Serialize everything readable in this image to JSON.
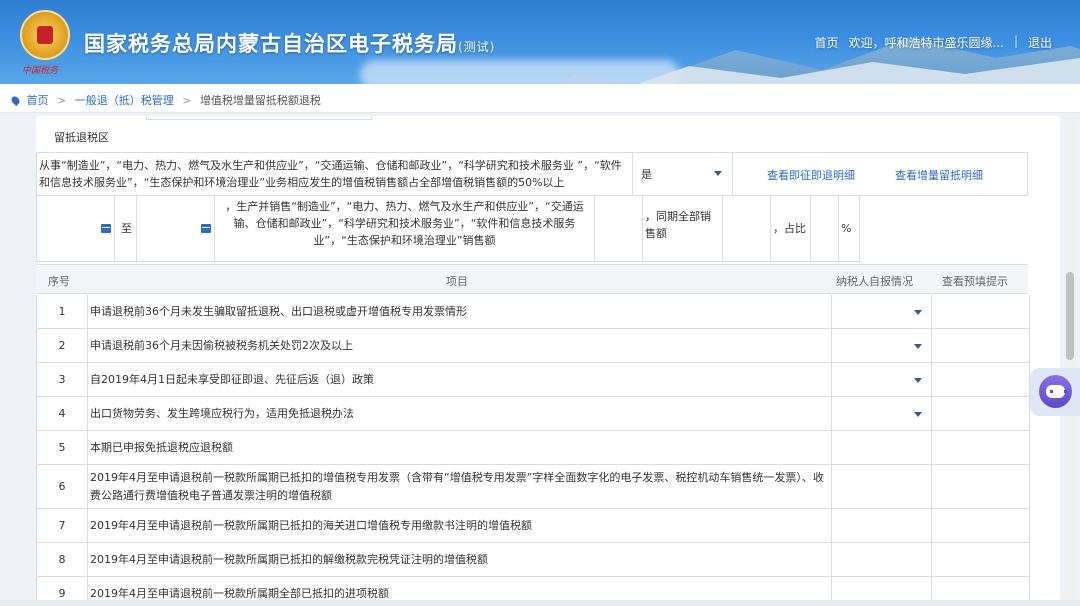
{
  "header": {
    "title": "国家税务总局内蒙古自治区电子税务局",
    "title_suffix": "(测试)",
    "emblem_caption": "中国税务",
    "nav": {
      "home": "首页",
      "welcome": "欢迎，呼和浩特市盛乐圆缘...",
      "separator": "|",
      "logout": "退出"
    }
  },
  "breadcrumb": {
    "home": "首页",
    "level1": "一般退（抵）税管理",
    "current": "增值税增量留抵税额退税",
    "arrow": ">"
  },
  "section": {
    "title": "留抵退税区"
  },
  "condition_row": {
    "description": "从事“制造业”，“电力、热力、燃气及水生产和供应业”，“交通运输、仓储和邮政业”，“科学研究和技术服务业 ”，“软件和信息技术服务业”，“生态保护和环境治理业”业务相应发生的增值税销售额占全部增值税销售额的50%以上",
    "select_value": "是",
    "link_refund_detail": "查看即征即退明细",
    "link_increment_detail": "查看增量留抵明细"
  },
  "period_row": {
    "to_label": "至",
    "desc": "，生产并销售“制造业”，“电力、热力、燃气及水生产和供应业”，“交通运输、仓储和邮政业”，“科学研究和技术服务业”，“软件和信息技术服务业”，“生态保护和环境治理业”销售额",
    "same_period_label": "，同期全部销售额",
    "ratio_label": "，占比",
    "percent": "%"
  },
  "table": {
    "headers": {
      "num": "序号",
      "item": "项目",
      "self_report": "纳税人自报情况",
      "hint": "查看预填提示"
    },
    "rows": [
      {
        "num": "1",
        "item": "申请退税前36个月未发生骗取留抵退税、出口退税或虚开增值税专用发票情形",
        "has_select": true
      },
      {
        "num": "2",
        "item": "申请退税前36个月未因偷税被税务机关处罚2次及以上",
        "has_select": true
      },
      {
        "num": "3",
        "item": "自2019年4月1日起未享受即征即退、先征后返（退）政策",
        "has_select": true
      },
      {
        "num": "4",
        "item": "出口货物劳务、发生跨境应税行为，适用免抵退税办法",
        "has_select": true
      },
      {
        "num": "5",
        "item": "本期已申报免抵退税应退税额",
        "has_select": false
      },
      {
        "num": "6",
        "item": "2019年4月至申请退税前一税款所属期已抵扣的增值税专用发票（含带有“增值税专用发票”字样全面数字化的电子发票、税控机动车销售统一发票）、收费公路通行费增值税电子普通发票注明的增值税额",
        "has_select": false
      },
      {
        "num": "7",
        "item": "2019年4月至申请退税前一税款所属期已抵扣的海关进口增值税专用缴款书注明的增值税额",
        "has_select": false
      },
      {
        "num": "8",
        "item": "2019年4月至申请退税前一税款所属期已抵扣的解缴税款完税凭证注明的增值税额",
        "has_select": false
      },
      {
        "num": "9",
        "item": "2019年4月至申请退税前一税款所属期全部已抵扣的进项税额",
        "has_select": false
      }
    ]
  },
  "icons": {
    "location": "location-pin-icon",
    "calendar": "calendar-icon",
    "dropdown": "chevron-down-icon",
    "assistant": "robot-assistant-icon"
  },
  "colors": {
    "header_blue": "#2f7fd3",
    "link_blue": "#2b6cc4",
    "assistant_purple": "#5b49c9"
  }
}
